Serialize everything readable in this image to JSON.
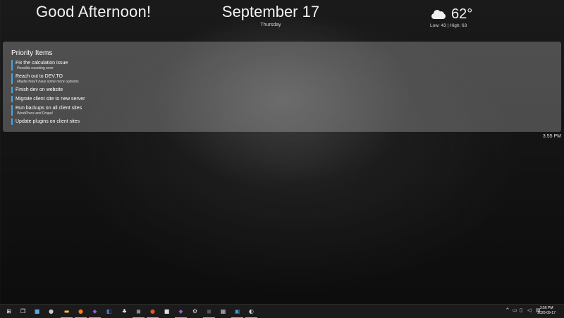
{
  "greeting": "Good Afternoon!",
  "date": {
    "main": "September 17",
    "weekday": "Thursday"
  },
  "weather": {
    "temp": "62°",
    "range": "Low: 43 | High: 63",
    "icon": "cloud-icon"
  },
  "priority": {
    "title": "Priority Items",
    "items": [
      {
        "title": "Fix the calculation issue",
        "note": "Possible rounding error"
      },
      {
        "title": "Reach out to DEV.TO",
        "note": "Maybe they'll have some more opinions"
      },
      {
        "title": "Finish dev on website",
        "note": ""
      },
      {
        "title": "Migrate client site to new server",
        "note": ""
      },
      {
        "title": "Run backups on all client sites",
        "note": "WordPress and Drupal"
      },
      {
        "title": "Update plugins on client sites",
        "note": ""
      }
    ],
    "time": "3:55 PM"
  },
  "taskbar": {
    "icons": [
      {
        "name": "windows-start-icon",
        "glyph": "⊞",
        "color": "#ffffff",
        "active": false
      },
      {
        "name": "task-view-icon",
        "glyph": "❒",
        "color": "#ffffff",
        "active": false
      },
      {
        "name": "app-icon-1",
        "glyph": "■",
        "color": "#5aa9e6",
        "active": false
      },
      {
        "name": "app-icon-2",
        "glyph": "●",
        "color": "#cccccc",
        "active": false
      },
      {
        "name": "file-explorer-icon",
        "glyph": "▬",
        "color": "#f2c14e",
        "active": true
      },
      {
        "name": "firefox-icon",
        "glyph": "●",
        "color": "#ff7b1c",
        "active": true
      },
      {
        "name": "visual-studio-icon",
        "glyph": "◆",
        "color": "#8a5cd1",
        "active": true
      },
      {
        "name": "app-icon-3",
        "glyph": "◧",
        "color": "#4d7de0",
        "active": false
      },
      {
        "name": "app-icon-4",
        "glyph": "♣",
        "color": "#e0e0e0",
        "active": false
      },
      {
        "name": "app-icon-5",
        "glyph": "◼",
        "color": "#888888",
        "active": true
      },
      {
        "name": "ubuntu-icon",
        "glyph": "●",
        "color": "#e95420",
        "active": true
      },
      {
        "name": "app-icon-6",
        "glyph": "■",
        "color": "#e0e0e0",
        "active": false
      },
      {
        "name": "vscode-icon",
        "glyph": "◆",
        "color": "#9b59d0",
        "active": true
      },
      {
        "name": "gear-icon",
        "glyph": "⚙",
        "color": "#dddddd",
        "active": false
      },
      {
        "name": "app-icon-7",
        "glyph": "◼",
        "color": "#555555",
        "active": true
      },
      {
        "name": "app-icon-8",
        "glyph": "▦",
        "color": "#cccccc",
        "active": false
      },
      {
        "name": "app-icon-9",
        "glyph": "▣",
        "color": "#3ba1d8",
        "active": true
      },
      {
        "name": "app-icon-10",
        "glyph": "◐",
        "color": "#dddddd",
        "active": true
      }
    ],
    "tray": [
      {
        "name": "chevron-up-icon",
        "glyph": "^"
      },
      {
        "name": "battery-icon",
        "glyph": "▭"
      },
      {
        "name": "network-icon",
        "glyph": "▯"
      },
      {
        "name": "volume-icon",
        "glyph": "◁"
      },
      {
        "name": "keyboard-icon",
        "glyph": "▤"
      }
    ],
    "time": "3:56 PM",
    "date": "2020-09-17"
  }
}
